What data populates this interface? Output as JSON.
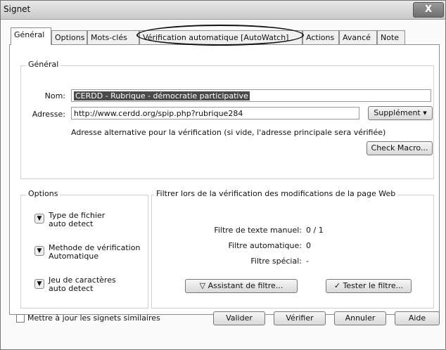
{
  "window": {
    "title": "Signet",
    "close_label": "X"
  },
  "tabs": [
    {
      "label": "Général",
      "active": true
    },
    {
      "label": "Options"
    },
    {
      "label": "Mots-clés"
    },
    {
      "label": "Vérification automatique [AutoWatch]"
    },
    {
      "label": "Actions"
    },
    {
      "label": "Avancé"
    },
    {
      "label": "Note"
    }
  ],
  "general": {
    "group_title": "Général",
    "name_label": "Nom:",
    "name_value": "CERDD - Rubrique - démocratie participative",
    "address_label": "Adresse:",
    "address_value": "http://www.cerdd.org/spip.php?rubrique284",
    "supplement_button": "Supplément ▾",
    "alt_address_text": "Adresse alternative pour la vérification (si vide, l'adresse principale sera vérifiée)",
    "check_macro_button": "Check Macro..."
  },
  "options": {
    "group_title": "Options",
    "items": [
      {
        "title": "Type de fichier",
        "value": "auto detect"
      },
      {
        "title": "Methode de vérification",
        "value": "Automatique"
      },
      {
        "title": "Jeu de caractères",
        "value": "auto detect"
      }
    ]
  },
  "filter": {
    "group_title": "Filtrer lors de la vérification des modifications de la page Web",
    "manual_label": "Filtre de texte manuel:",
    "manual_value": "0 / 1",
    "auto_label": "Filtre automatique:",
    "auto_value": "0",
    "special_label": "Filtre spécial:",
    "special_value": "-",
    "assistant_button": "Assistant de filtre...",
    "test_button": "Tester le filtre..."
  },
  "footer": {
    "update_similar_label": "Mettre à jour les signets similaires",
    "validate_button": "Valider",
    "verify_button": "Vérifier",
    "cancel_button": "Annuler",
    "help_button": "Aide"
  },
  "icons": {
    "funnel": "funnel-icon",
    "check": "checkmark-icon",
    "chevron": "chevron-down-icon"
  }
}
